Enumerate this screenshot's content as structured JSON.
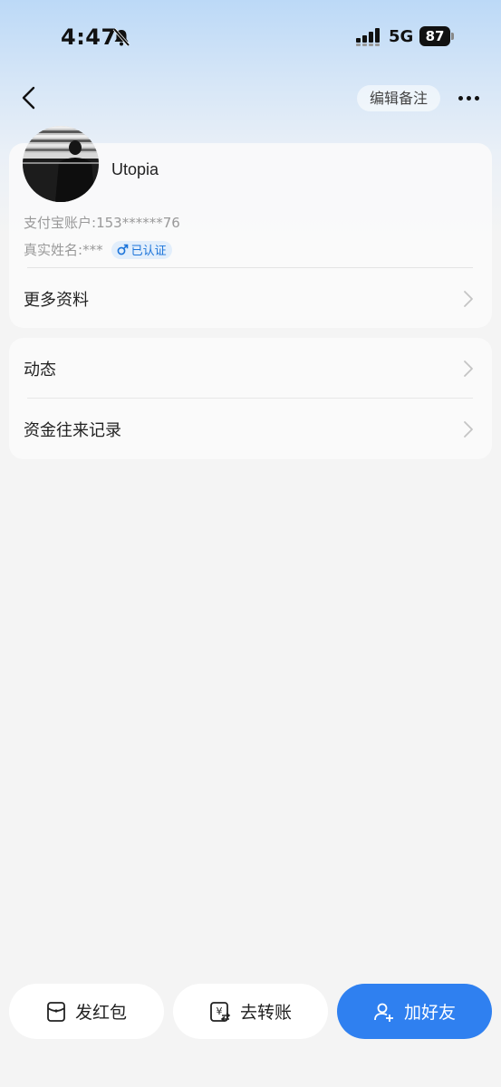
{
  "status_bar": {
    "time": "4:47",
    "network": "5G",
    "battery": "87"
  },
  "nav": {
    "edit_note_label": "编辑备注"
  },
  "profile": {
    "username": "Utopia",
    "account_label": "支付宝账户:",
    "account_value": "153******76",
    "realname_label": "真实姓名:",
    "realname_value": "***",
    "verified_label": "已认证",
    "more_info_label": "更多资料"
  },
  "list": {
    "moments_label": "动态",
    "fund_records_label": "资金往来记录"
  },
  "bottom": {
    "red_packet_label": "发红包",
    "transfer_label": "去转账",
    "add_friend_label": "加好友"
  },
  "colors": {
    "accent": "#2f80f0",
    "verified": "#1a73d9"
  },
  "icons": [
    "bell-muted-icon",
    "signal-icon",
    "battery-icon",
    "back-arrow-icon",
    "more-dots-icon",
    "male-icon",
    "chevron-right-icon",
    "red-packet-icon",
    "transfer-icon",
    "add-friend-icon"
  ]
}
